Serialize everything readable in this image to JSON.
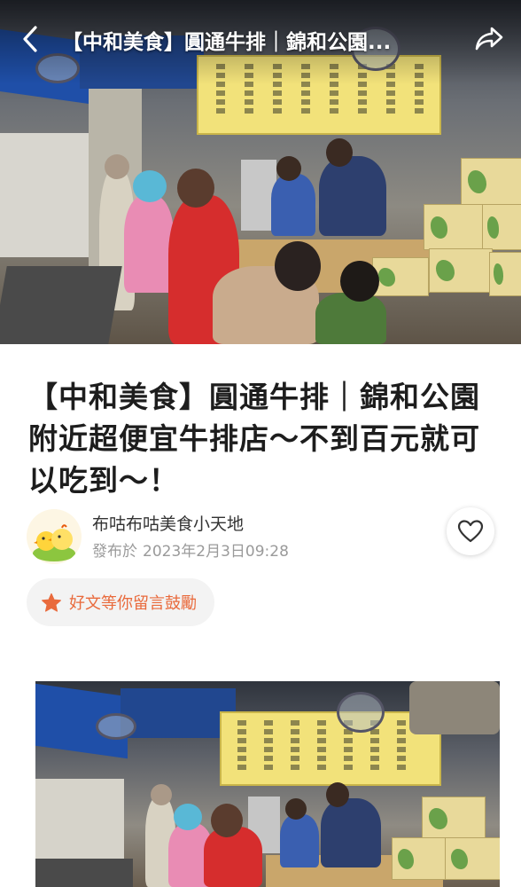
{
  "topbar": {
    "title": "【中和美食】圓通牛排｜錦和公園..."
  },
  "article": {
    "title": "【中和美食】圓通牛排｜錦和公園附近超便宜牛排店～不到百元就可以吃到～！",
    "author_name": "布咕布咕美食小天地",
    "posted_prefix": "發布於",
    "posted_date": "2023年2月3日09:28"
  },
  "encourage": {
    "label": "好文等你留言鼓勵"
  },
  "icons": {
    "back": "chevron-left-icon",
    "share": "share-arrow-icon",
    "like": "heart-icon",
    "star": "star-icon"
  },
  "colors": {
    "accent": "#e96a3c",
    "chip_bg": "#f3f3f3",
    "date_text": "#9a9a9a"
  }
}
